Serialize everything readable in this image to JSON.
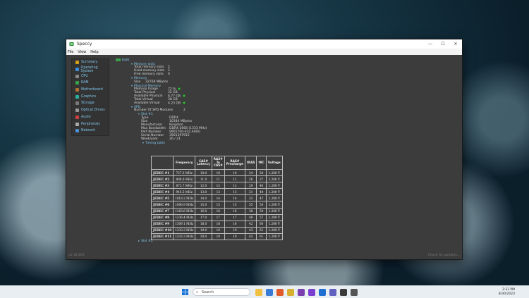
{
  "window": {
    "title": "Speccy",
    "menu": [
      "File",
      "View",
      "Help"
    ],
    "min": "—",
    "max": "☐",
    "close": "✕"
  },
  "sidebar": {
    "items": [
      {
        "label": "Summary",
        "color": "#d4a017"
      },
      {
        "label": "Operating System",
        "color": "#3a8de0"
      },
      {
        "label": "CPU",
        "color": "#888888"
      },
      {
        "label": "RAM",
        "color": "#3aa04a"
      },
      {
        "label": "Motherboard",
        "color": "#b07030"
      },
      {
        "label": "Graphics",
        "color": "#2bb0a0"
      },
      {
        "label": "Storage",
        "color": "#7a7a7a"
      },
      {
        "label": "Optical Drives",
        "color": "#999999"
      },
      {
        "label": "Audio",
        "color": "#d04040"
      },
      {
        "label": "Peripherals",
        "color": "#aaaaaa"
      },
      {
        "label": "Network",
        "color": "#4a90d0"
      }
    ]
  },
  "ram": {
    "title": "RAM",
    "memory_slots": {
      "heading": "Memory slots",
      "rows": [
        {
          "k": "Total memory slots",
          "v": "2"
        },
        {
          "k": "Used memory slots",
          "v": "2"
        },
        {
          "k": "Free memory slots",
          "v": "0"
        }
      ]
    },
    "memory": {
      "heading": "Memory",
      "rows": [
        {
          "k": "Size",
          "v": "32768 MBytes"
        }
      ]
    },
    "physical": {
      "heading": "Physical Memory",
      "rows": [
        {
          "k": "Memory Usage",
          "v": "72 %",
          "ok": true
        },
        {
          "k": "Total Physical",
          "v": "32 GB",
          "ok": false
        },
        {
          "k": "Available Physical",
          "v": "8.77 GB",
          "ok": true
        },
        {
          "k": "Total Virtual",
          "v": "38 GB",
          "ok": false
        },
        {
          "k": "Available Virtual",
          "v": "4.23 GB",
          "ok": true
        }
      ]
    },
    "spd": {
      "heading": "SPD",
      "modules_label": "Number Of SPD Modules",
      "modules_value": "2",
      "slot1": {
        "heading": "Slot #1",
        "rows": [
          {
            "k": "Type",
            "v": "DDR4"
          },
          {
            "k": "Size",
            "v": "16384 MBytes"
          },
          {
            "k": "Manufacturer",
            "v": "Kingston"
          },
          {
            "k": "Max Bandwidth",
            "v": "DDR4-2666 (1333 MHz)"
          },
          {
            "k": "Part Number",
            "v": "9905700-032.A00G"
          },
          {
            "k": "Serial Number",
            "v": "3561397915"
          },
          {
            "k": "Week/year",
            "v": "26 / 21"
          }
        ]
      },
      "timing_heading": "Timing table",
      "slot2": "Slot #2"
    }
  },
  "timing": {
    "headers": [
      "",
      "Frequency",
      "CAS# Latency",
      "RAS# To CAS#",
      "RAS# Precharge",
      "tRAS",
      "tRC",
      "Voltage"
    ],
    "rows": [
      [
        "JEDEC #1",
        "727.3 MHz",
        "10.0",
        "10",
        "10",
        "24",
        "34",
        "1.200 V"
      ],
      [
        "JEDEC #2",
        "800.0 MHz",
        "11.0",
        "11",
        "11",
        "26",
        "37",
        "1.200 V"
      ],
      [
        "JEDEC #3",
        "872.7 MHz",
        "12.0",
        "12",
        "12",
        "29",
        "40",
        "1.200 V"
      ],
      [
        "JEDEC #4",
        "945.5 MHz",
        "13.0",
        "13",
        "13",
        "31",
        "44",
        "1.200 V"
      ],
      [
        "JEDEC #5",
        "1018.2 MHz",
        "14.0",
        "14",
        "14",
        "33",
        "47",
        "1.200 V"
      ],
      [
        "JEDEC #6",
        "1090.9 MHz",
        "15.0",
        "15",
        "15",
        "35",
        "50",
        "1.200 V"
      ],
      [
        "JEDEC #7",
        "1163.6 MHz",
        "16.0",
        "16",
        "16",
        "38",
        "54",
        "1.200 V"
      ],
      [
        "JEDEC #8",
        "1236.4 MHz",
        "17.0",
        "17",
        "17",
        "40",
        "57",
        "1.200 V"
      ],
      [
        "JEDEC #9",
        "1309.1 MHz",
        "18.0",
        "18",
        "18",
        "42",
        "60",
        "1.200 V"
      ],
      [
        "JEDEC #10",
        "1333.3 MHz",
        "19.0",
        "19",
        "19",
        "43",
        "61",
        "1.200 V"
      ],
      [
        "JEDEC #11",
        "1333.3 MHz",
        "20.0",
        "19",
        "19",
        "43",
        "61",
        "1.200 V"
      ]
    ]
  },
  "status": {
    "version": "v1.32.803",
    "update": "Check for updates..."
  },
  "taskbar": {
    "search_placeholder": "Search",
    "time": "3:33 PM",
    "date": "8/30/2023",
    "icon_colors": [
      "#f0c040",
      "#3a7bd5",
      "#e05a2a",
      "#d8b030",
      "#7b3fb0",
      "#7a3fd0",
      "#1f6fd0",
      "#6060c0",
      "#3a3a3a",
      "#555555"
    ]
  }
}
